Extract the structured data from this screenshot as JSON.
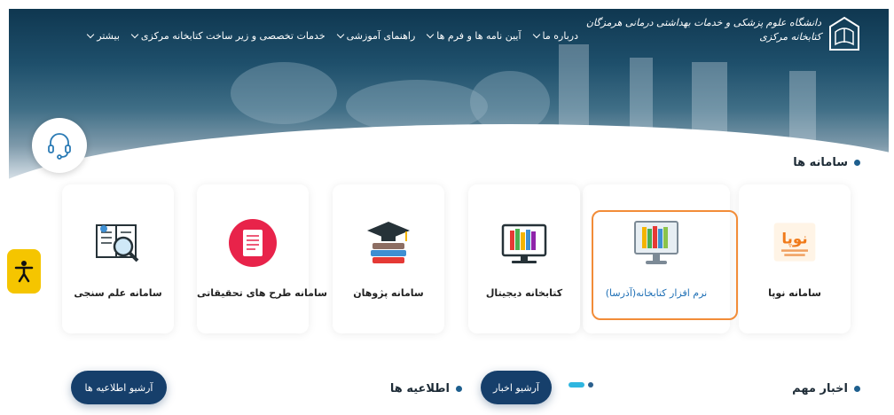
{
  "header": {
    "logo_line1": "دانشگاه علوم پزشکی و خدمات بهداشتی درمانی هرمزگان",
    "logo_line2": "کتابخانه مرکزی",
    "nav": [
      {
        "label": "درباره ما"
      },
      {
        "label": "آیین نامه ها و فرم ها"
      },
      {
        "label": "راهنمای آموزشی"
      },
      {
        "label": "خدمات تخصصی و زیر ساخت کتابخانه مرکزی"
      },
      {
        "label": "بیشتر"
      }
    ]
  },
  "systems": {
    "heading": "سامانه ها",
    "cards": [
      {
        "label": "سامانه نوپا",
        "icon": "nopa-logo-icon"
      },
      {
        "label": "نرم افزار کتابخانه(آذرسا)",
        "icon": "computer-books-icon"
      },
      {
        "label": "کتابخانه دیجیتال",
        "icon": "digital-library-icon"
      },
      {
        "label": "سامانه پژوهان",
        "icon": "graduation-books-icon"
      },
      {
        "label": "سامانه طرح های تحقیقاتی",
        "icon": "research-document-icon"
      },
      {
        "label": "سامانه علم سنجی",
        "icon": "scientometrics-icon"
      }
    ],
    "nopa_logo_text": "نوپا"
  },
  "news": {
    "heading": "اخبار مهم",
    "archive_button": "آرشیو اخبار"
  },
  "announcements": {
    "heading": "اطلاعیه ها",
    "archive_button": "آرشیو اطلاعیه ها"
  },
  "colors": {
    "accent": "#163f6b",
    "highlight": "#f28c38",
    "a11y": "#f5c500"
  }
}
